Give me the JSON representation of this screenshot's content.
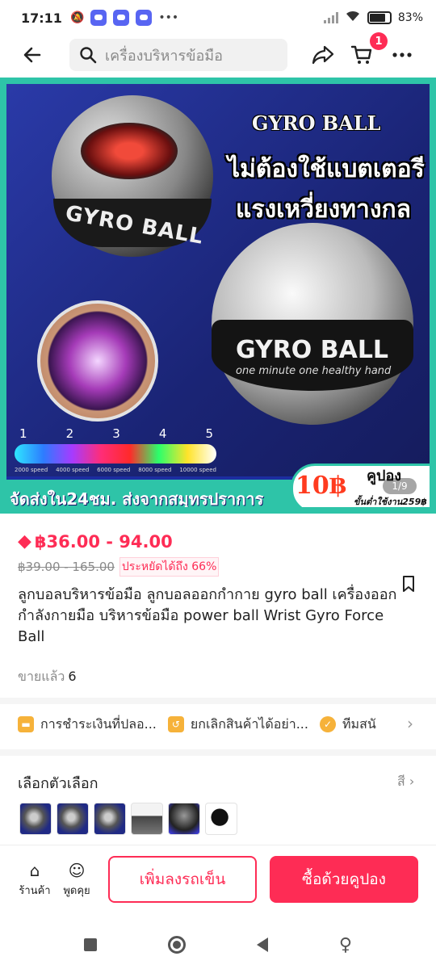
{
  "status": {
    "time": "17:11",
    "battery": "83",
    "battery_level": 0.83
  },
  "search": {
    "placeholder": "เครื่องบริหารข้อมือ"
  },
  "header": {
    "cart_count": "1"
  },
  "hero": {
    "headline": "GYRO BALL",
    "line1": "ไม่ต้องใช้แบตเตอรี",
    "line2": "แรงเหวี่ยงทางกล",
    "ball_label": "GYRO BALL",
    "ball_sub": "one minute one healthy hand",
    "small_ball_label": "GYRO BALL",
    "speed_levels": [
      "1",
      "2",
      "3",
      "4",
      "5"
    ],
    "speed_labels": [
      "2000 speed",
      "4000 speed",
      "6000 speed",
      "8000 speed",
      "10000 speed"
    ],
    "promo": "จัดส่งใน24ชม. ส่งจากสมุทรปราการ",
    "coupon_amount": "10฿",
    "coupon_word": "คูปอง",
    "coupon_condition": "ขั้นต่ำใช้งาน259฿",
    "counter": "1/9"
  },
  "product": {
    "price": "฿36.00 - 94.00",
    "old_price": "฿39.00 - 165.00",
    "discount": "ประหยัดได้ถึง 66%",
    "title": "ลูกบอลบริหารข้อมือ ลูกบอลออกกำกาย gyro ball เครื่องออกกำลังกายมือ บริหารข้อมือ power ball Wrist Gyro Force Ball",
    "sold_label": "ขายแล้ว",
    "sold_count": "6"
  },
  "benefits": [
    {
      "label": "การชำระเงินที่ปลอ...",
      "icon": "wallet-icon"
    },
    {
      "label": "ยกเลิกสินค้าได้อย่า...",
      "icon": "return-box-icon"
    },
    {
      "label": "ทีมสนั",
      "icon": "check-badge-icon"
    }
  ],
  "options": {
    "heading": "เลือกตัวเลือก",
    "right_label": "สี"
  },
  "bottom": {
    "shop_label": "ร้านค้า",
    "chat_label": "พูดคุย",
    "add_to_cart": "เพิ่มลงรถเข็น",
    "buy_with_coupon": "ซื้อด้วยคูปอง"
  },
  "colors": {
    "accent": "#fe2c55",
    "promo_green": "#2ec4a8",
    "hero_blue": "#1c2da0"
  }
}
